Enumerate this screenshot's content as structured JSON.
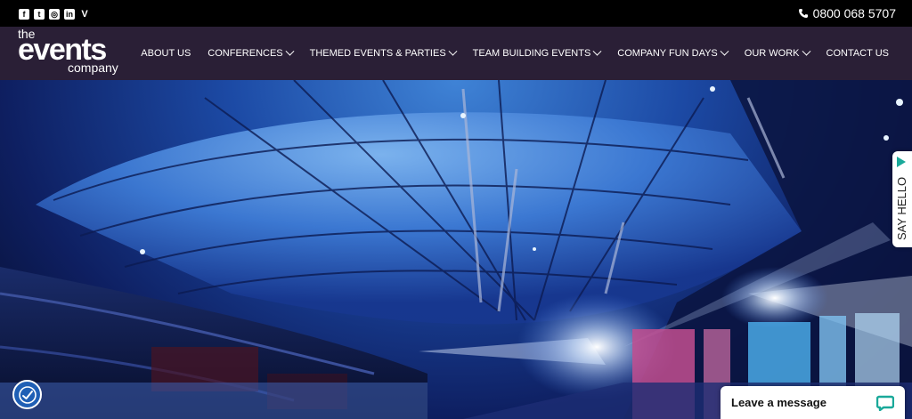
{
  "topbar": {
    "social": [
      {
        "icon": "facebook-icon",
        "glyph": "f"
      },
      {
        "icon": "twitter-icon",
        "glyph": "t"
      },
      {
        "icon": "instagram-icon",
        "glyph": "◎"
      },
      {
        "icon": "linkedin-icon",
        "glyph": "in"
      },
      {
        "icon": "vimeo-icon",
        "glyph": "V"
      }
    ],
    "phone": "0800 068 5707"
  },
  "logo": {
    "line1": "the",
    "line2": "events",
    "line3": "company"
  },
  "nav": [
    {
      "label": "ABOUT US",
      "dropdown": false
    },
    {
      "label": "CONFERENCES",
      "dropdown": true
    },
    {
      "label": "THEMED EVENTS & PARTIES",
      "dropdown": true
    },
    {
      "label": "TEAM BUILDING EVENTS",
      "dropdown": true
    },
    {
      "label": "COMPANY FUN DAYS",
      "dropdown": true
    },
    {
      "label": "OUR WORK",
      "dropdown": true
    },
    {
      "label": "CONTACT US",
      "dropdown": false
    }
  ],
  "say_hello": "SAY HELLO",
  "chat": {
    "label": "Leave a message"
  },
  "colors": {
    "nav_bg": "#2a1f36",
    "topbar_bg": "#000000",
    "chat_accent": "#1aa99a",
    "a11y_bg": "#1f5fb5"
  }
}
